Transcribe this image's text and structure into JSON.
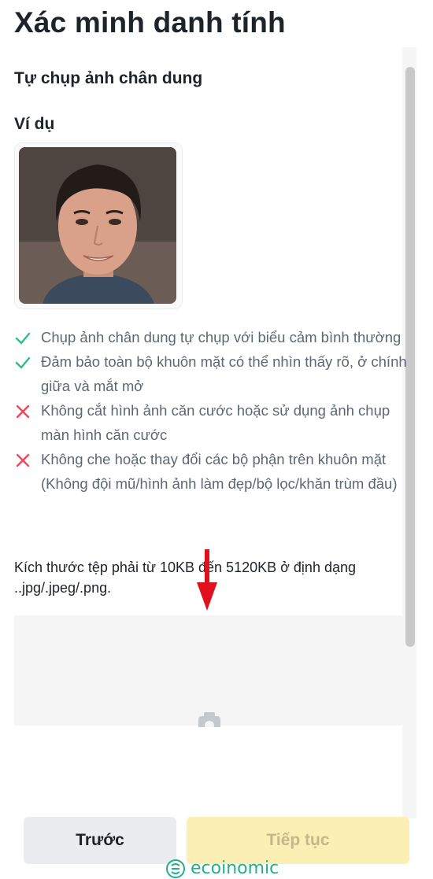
{
  "page": {
    "title": "Xác minh danh tính"
  },
  "section": {
    "title": "Tự chụp ảnh chân dung",
    "example_label": "Ví dụ"
  },
  "rules": [
    {
      "type": "ok",
      "text": "Chụp ảnh chân dung tự chụp với biểu cảm bình thường"
    },
    {
      "type": "ok",
      "text": "Đảm bảo toàn bộ khuôn mặt có thể nhìn thấy rõ, ở chính giữa và mắt mở"
    },
    {
      "type": "no",
      "text": "Không cắt hình ảnh căn cước hoặc sử dụng ảnh chụp màn hình căn cước"
    },
    {
      "type": "no",
      "text": "Không che hoặc thay đổi các bộ phận trên khuôn mặt (Không đội mũ/hình ảnh làm đẹp/bộ lọc/khăn trùm đầu)"
    }
  ],
  "upload": {
    "note": "Kích thước tệp phải từ 10KB đến 5120KB ở định dạng ..jpg/.jpeg/.png."
  },
  "buttons": {
    "prev": "Trước",
    "next": "Tiếp tục"
  },
  "watermark": {
    "text": "ecoinomic"
  },
  "colors": {
    "check": "#2ebd85",
    "cross": "#f6465d",
    "primary_disabled": "#fcefb4",
    "arrow": "#e0101c",
    "watermark": "#22b08a"
  }
}
